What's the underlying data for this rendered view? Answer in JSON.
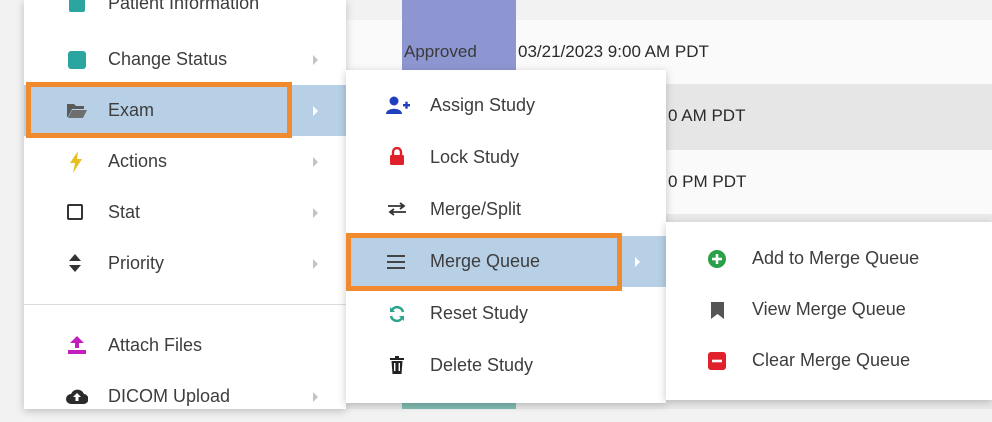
{
  "background": {
    "status": "Approved",
    "rows": [
      "03/21/2023 9:00 AM PDT",
      "0 AM PDT",
      "0 PM PDT"
    ]
  },
  "main_menu": {
    "items": [
      {
        "label": "Patient Information",
        "icon": "patient-info-icon"
      },
      {
        "label": "Change Status",
        "icon": "status-square-icon"
      },
      {
        "label": "Exam",
        "icon": "folder-open-icon"
      },
      {
        "label": "Actions",
        "icon": "lightning-bolt-icon"
      },
      {
        "label": "Stat",
        "icon": "checkbox-square-icon"
      },
      {
        "label": "Priority",
        "icon": "sort-arrows-icon"
      },
      {
        "label": "Attach Files",
        "icon": "upload-icon"
      },
      {
        "label": "DICOM Upload",
        "icon": "cloud-upload-icon"
      }
    ]
  },
  "exam_submenu": {
    "items": [
      {
        "label": "Assign Study",
        "icon": "user-plus-icon"
      },
      {
        "label": "Lock Study",
        "icon": "lock-icon"
      },
      {
        "label": "Merge/Split",
        "icon": "swap-arrows-icon"
      },
      {
        "label": "Merge Queue",
        "icon": "hamburger-lines-icon"
      },
      {
        "label": "Reset Study",
        "icon": "refresh-icon"
      },
      {
        "label": "Delete Study",
        "icon": "trash-icon"
      }
    ]
  },
  "queue_submenu": {
    "items": [
      {
        "label": "Add to Merge Queue",
        "icon": "plus-circle-icon"
      },
      {
        "label": "View Merge Queue",
        "icon": "bookmark-icon"
      },
      {
        "label": "Clear Merge Queue",
        "icon": "minus-box-icon"
      }
    ]
  },
  "colors": {
    "highlight": "#b8d0e6",
    "callout": "#f08a2c",
    "status": "#8e96d2"
  }
}
